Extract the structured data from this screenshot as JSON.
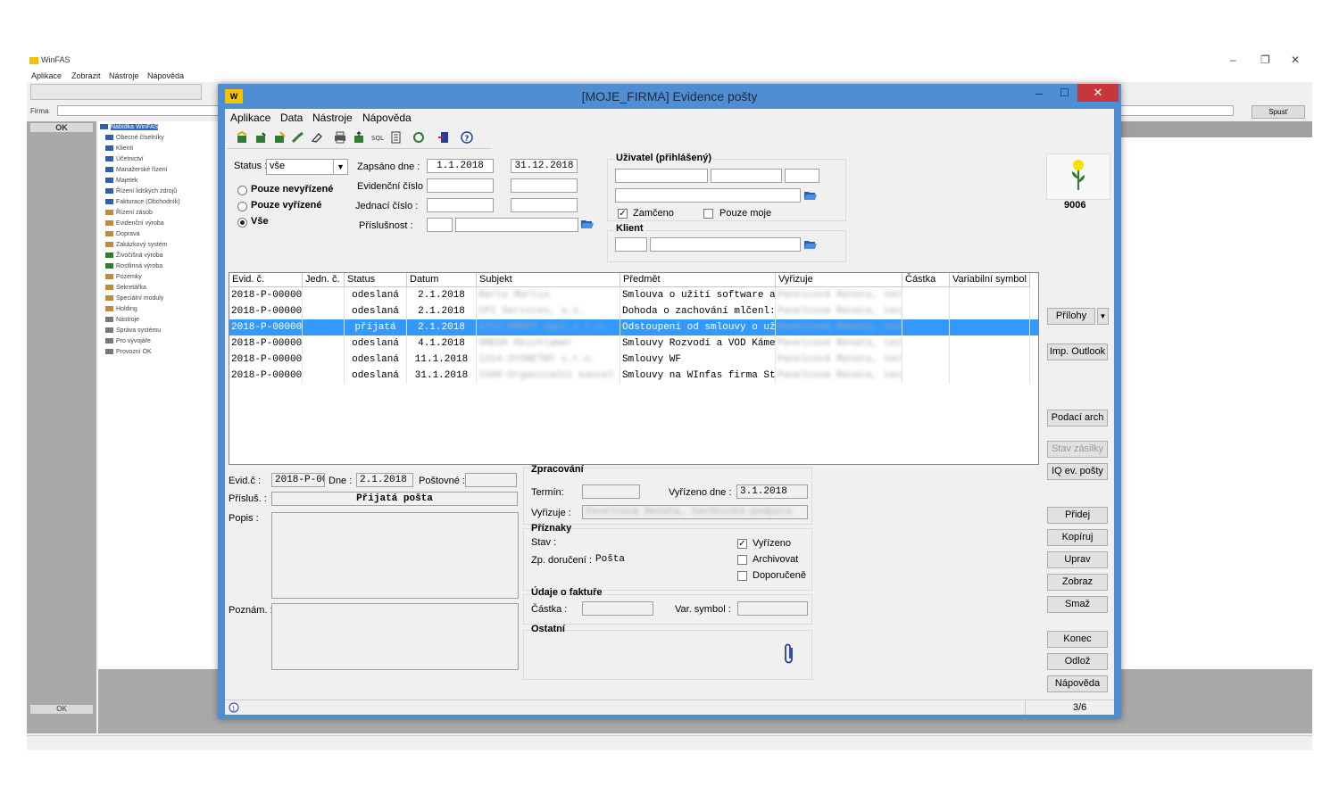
{
  "background_app": {
    "title": "WinFAS",
    "menu": [
      "Aplikace",
      "Zobrazit",
      "Nástroje",
      "Nápověda"
    ],
    "firma_label": "Firma",
    "ok_label": "OK",
    "ok2_label": "OK",
    "spust_label": "Spusť",
    "tree": [
      "Nabídka WinFAS",
      "Obecné číselníky",
      "Klienti",
      "Účetnictví",
      "Manažerské řízení",
      "Majetek",
      "Řízení lidských zdrojů",
      "Fakturace (Obchodník)",
      "Řízení zásob",
      "Evidenční výroba",
      "Doprava",
      "Zakázkový systém",
      "Živočišná výroba",
      "Rostlinná výroba",
      "Pozemky",
      "Sekretářka",
      "Speciální moduly",
      "Holding",
      "Nástroje",
      "Správa systému",
      "Pro vývojáře",
      "Provozní OK"
    ]
  },
  "dialog": {
    "title": "[MOJE_FIRMA] Evidence pošty",
    "menu": [
      "Aplikace",
      "Data",
      "Nástroje",
      "Nápověda"
    ],
    "filter": {
      "status_label": "Status :",
      "status_value": "vše",
      "radio_options": [
        "Pouze nevyřízené",
        "Pouze vyřízené",
        "Vše"
      ],
      "radio_selected": 2,
      "zapsano_label": "Zapsáno dne :",
      "date_from": "1.1.2018",
      "date_to": "31.12.2018",
      "evid_cislo_label": "Evidenční číslo :",
      "jednaci_cislo_label": "Jednací číslo :",
      "prislusnost_label": "Příslušnost :"
    },
    "uzivatel": {
      "title": "Uživatel (přihlášený)",
      "zamceno_label": "Zamčeno",
      "zamceno_checked": true,
      "pouze_moje_label": "Pouze moje",
      "pouze_moje_checked": false
    },
    "klient": {
      "title": "Klient"
    },
    "badge_number": "9006",
    "table": {
      "headers": [
        "Evid. č.",
        "Jedn. č.",
        "Status",
        "Datum",
        "Subjekt",
        "Předmět",
        "Vyřizuje",
        "Částka",
        "Variabilní symbol"
      ],
      "rows": [
        {
          "evid": "2018-P-00000",
          "jedn": "",
          "status": "odeslaná",
          "datum": "2.1.2018",
          "subjekt": "Bárta Martin",
          "predmet": "Smlouva o užití software a",
          "vyrizuje": "Pavelcová Renata, tech"
        },
        {
          "evid": "2018-P-00000",
          "jedn": "",
          "status": "odeslaná",
          "datum": "2.1.2018",
          "subjekt": "CPI Services, a.s.",
          "predmet": "Dohoda o zachování mlčenl:",
          "vyrizuje": "Pavelcová Renata, tech"
        },
        {
          "evid": "2018-P-00000",
          "jedn": "",
          "status": "přijatá",
          "datum": "2.1.2018",
          "subjekt": "1712-DRAFT spol.s r.o.",
          "predmet": "Odstoupení od smlouvy o už",
          "vyrizuje": "Pavelcová Renata, tech"
        },
        {
          "evid": "2018-P-00000",
          "jedn": "",
          "status": "odeslaná",
          "datum": "4.1.2018",
          "subjekt": "OMEGA Reichlamer",
          "predmet": "Smlouvy Rozvodí a VOD Káme",
          "vyrizuje": "Pavelcová Renata, tech"
        },
        {
          "evid": "2018-P-00000",
          "jedn": "",
          "status": "odeslaná",
          "datum": "11.1.2018",
          "subjekt": "1314-SYSNETBY s.r.o.",
          "predmet": "Smlouvy WF",
          "vyrizuje": "Pavelcová Renata, tech"
        },
        {
          "evid": "2018-P-00000",
          "jedn": "",
          "status": "odeslaná",
          "datum": "31.1.2018",
          "subjekt": "1500-Organizační kancel",
          "predmet": "Smlouvy na WInfas firma St",
          "vyrizuje": "Pavelcová Renata, tech"
        }
      ],
      "selected_row": 2
    },
    "detail": {
      "evid_label": "Evid.č :",
      "evid_value": "2018-P-00",
      "dne_label": "Dne :",
      "dne_value": "2.1.2018",
      "postovne_label": "Poštovné :",
      "prislus_label": "Přísluš. :",
      "prislus_value": "Přijatá pošta",
      "popis_label": "Popis :",
      "poznam_label": "Poznám. :"
    },
    "zpracovani": {
      "title": "Zpracování",
      "termin_label": "Termín:",
      "vyrizeno_dne_label": "Vyřízeno dne :",
      "vyrizeno_dne_value": "3.1.2018",
      "vyrizuje_label": "Vyřizuje :",
      "vyrizuje_value": "Pavelcová Renata, technická podpora"
    },
    "priznaky": {
      "title": "Příznaky",
      "stav_label": "Stav :",
      "zp_doruceni_label": "Zp. doručení :",
      "zp_doruceni_value": "Pošta",
      "vyrizeno_label": "Vyřízeno",
      "vyrizeno_checked": true,
      "archivovat_label": "Archivovat",
      "doporuceno_label": "Doporučeně"
    },
    "faktura": {
      "title": "Údaje o faktuře",
      "castka_label": "Částka :",
      "var_symbol_label": "Var. symbol :"
    },
    "ostatni": {
      "title": "Ostatní"
    },
    "buttons": {
      "prilohy": "Přílohy",
      "imp_outlook": "Imp. Outlook",
      "podaci_arch": "Podací arch",
      "stav_zasilky": "Stav zásilky",
      "iq_ev_posty": "IQ ev. pošty",
      "pridej": "Přidej",
      "kopiruj": "Kopíruj",
      "uprav": "Uprav",
      "zobraz": "Zobraz",
      "smaz": "Smaž",
      "konec": "Konec",
      "odloz": "Odlož",
      "napoveda": "Nápověda"
    },
    "status_bar": {
      "count": "3/6"
    }
  }
}
